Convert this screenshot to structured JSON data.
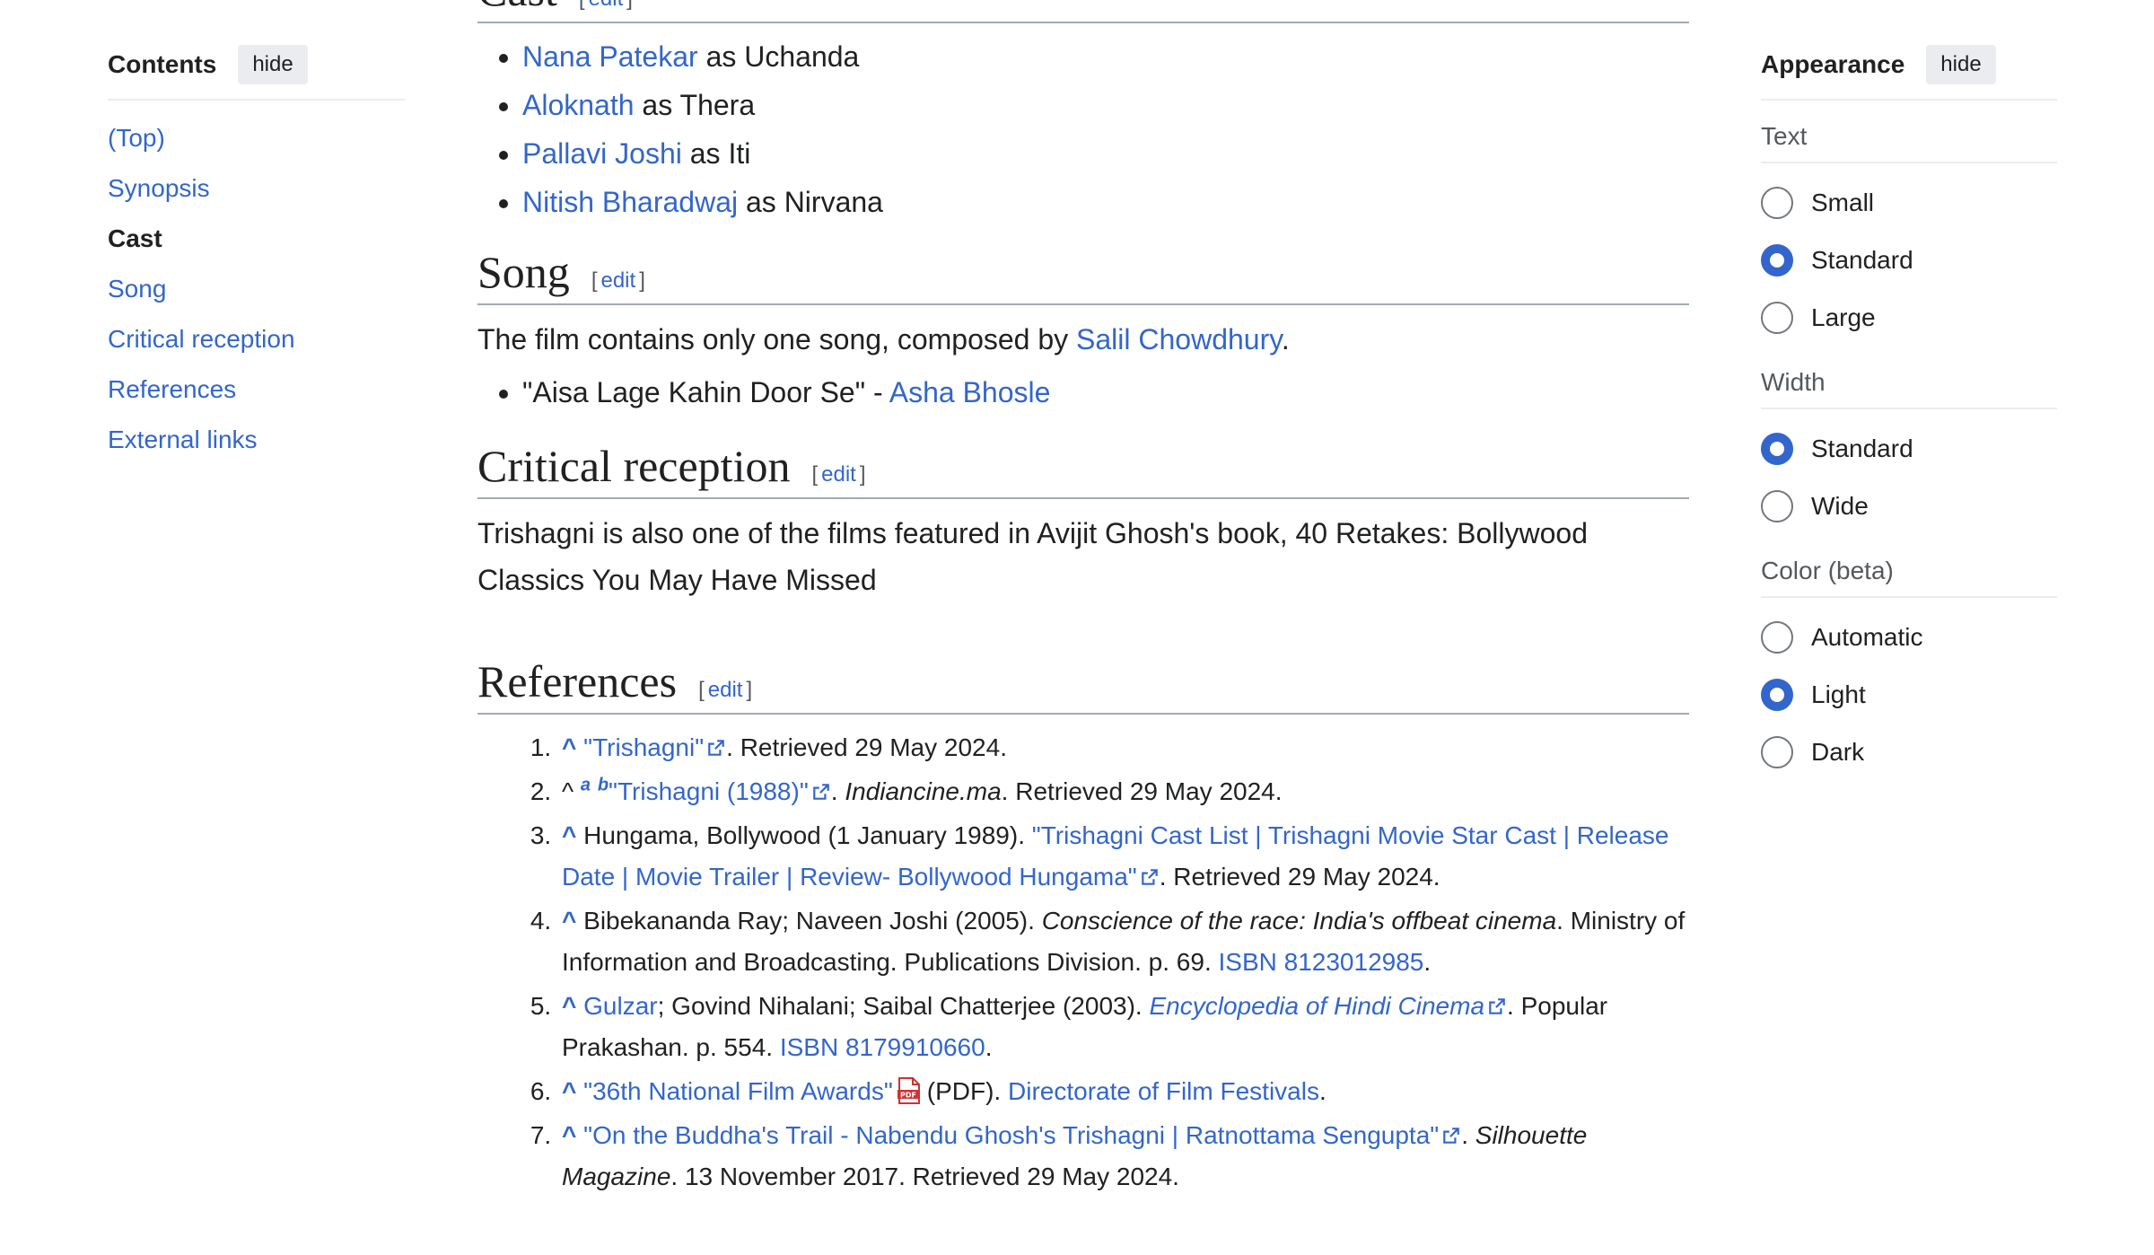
{
  "toc": {
    "title": "Contents",
    "hide_label": "hide",
    "items": [
      {
        "label": "(Top)",
        "active": false
      },
      {
        "label": "Synopsis",
        "active": false
      },
      {
        "label": "Cast",
        "active": true
      },
      {
        "label": "Song",
        "active": false
      },
      {
        "label": "Critical reception",
        "active": false
      },
      {
        "label": "References",
        "active": false
      },
      {
        "label": "External links",
        "active": false
      }
    ]
  },
  "cast": {
    "heading": "Cast",
    "edit_label": "edit",
    "members": [
      {
        "actor": "Nana Patekar",
        "role": "as Uchanda"
      },
      {
        "actor": "Aloknath",
        "role": "as Thera"
      },
      {
        "actor": "Pallavi Joshi",
        "role": "as Iti"
      },
      {
        "actor": "Nitish Bharadwaj",
        "role": "as Nirvana"
      }
    ]
  },
  "song": {
    "heading": "Song",
    "edit_label": "edit",
    "intro": "The film contains only one song, composed by",
    "composer": "Salil Chowdhury",
    "intro_end": ".",
    "track_title": "\"Aisa Lage Kahin Door Se\" -",
    "singer": "Asha Bhosle"
  },
  "critical": {
    "heading": "Critical reception",
    "edit_label": "edit",
    "text": "Trishagni is also one of the films featured in Avijit Ghosh's book, 40 Retakes: Bollywood Classics You May Have Missed"
  },
  "references": {
    "heading": "References",
    "edit_label": "edit",
    "items": {
      "r1": {
        "caret": "^",
        "link": "\"Trishagni\"",
        "after": ". Retrieved 29 May 2024."
      },
      "r2": {
        "caret": "^",
        "a": "a",
        "b": "b",
        "link": "\"Trishagni (1988)\"",
        "sep": ". ",
        "italic": "Indiancine.ma",
        "after": ". Retrieved 29 May 2024."
      },
      "r3": {
        "caret": "^",
        "before": "Hungama, Bollywood (1 January 1989).",
        "link": "\"Trishagni Cast List | Trishagni Movie Star Cast | Release Date | Movie Trailer | Review- Bollywood Hungama\"",
        "after": ". Retrieved 29 May 2024."
      },
      "r4": {
        "caret": "^",
        "before": "Bibekananda Ray; Naveen Joshi (2005).",
        "italic": "Conscience of the race: India's offbeat cinema",
        "mid": ". Ministry of Information and Broadcasting. Publications Division. p. 69.",
        "isbn": "ISBN 8123012985",
        "after": "."
      },
      "r5": {
        "caret": "^",
        "author_link": "Gulzar",
        "before": "; Govind Nihalani; Saibal Chatterjee (2003).",
        "italic_link": "Encyclopedia of Hindi Cinema",
        "mid": ". Popular Prakashan. p. 554.",
        "isbn": "ISBN 8179910660",
        "after": "."
      },
      "r6": {
        "caret": "^",
        "link": "\"36th National Film Awards\"",
        "pdf": "(PDF).",
        "org_link": "Directorate of Film Festivals",
        "after": "."
      },
      "r7": {
        "caret": "^",
        "link": "\"On the Buddha's Trail - Nabendu Ghosh's Trishagni | Ratnottama Sengupta\"",
        "sep": ". ",
        "italic": "Silhouette Magazine",
        "after": ". 13 November 2017. Retrieved 29 May 2024."
      }
    }
  },
  "appearance": {
    "title": "Appearance",
    "hide_label": "hide",
    "groups": {
      "text": {
        "label": "Text",
        "options": [
          "Small",
          "Standard",
          "Large"
        ],
        "selected": "Standard"
      },
      "width": {
        "label": "Width",
        "options": [
          "Standard",
          "Wide"
        ],
        "selected": "Standard"
      },
      "color": {
        "label": "Color (beta)",
        "options": [
          "Automatic",
          "Light",
          "Dark"
        ],
        "selected": "Light"
      }
    }
  },
  "colors": {
    "link": "#3366cc",
    "text": "#202122",
    "muted": "#54595d",
    "border": "#a2a9b1"
  }
}
